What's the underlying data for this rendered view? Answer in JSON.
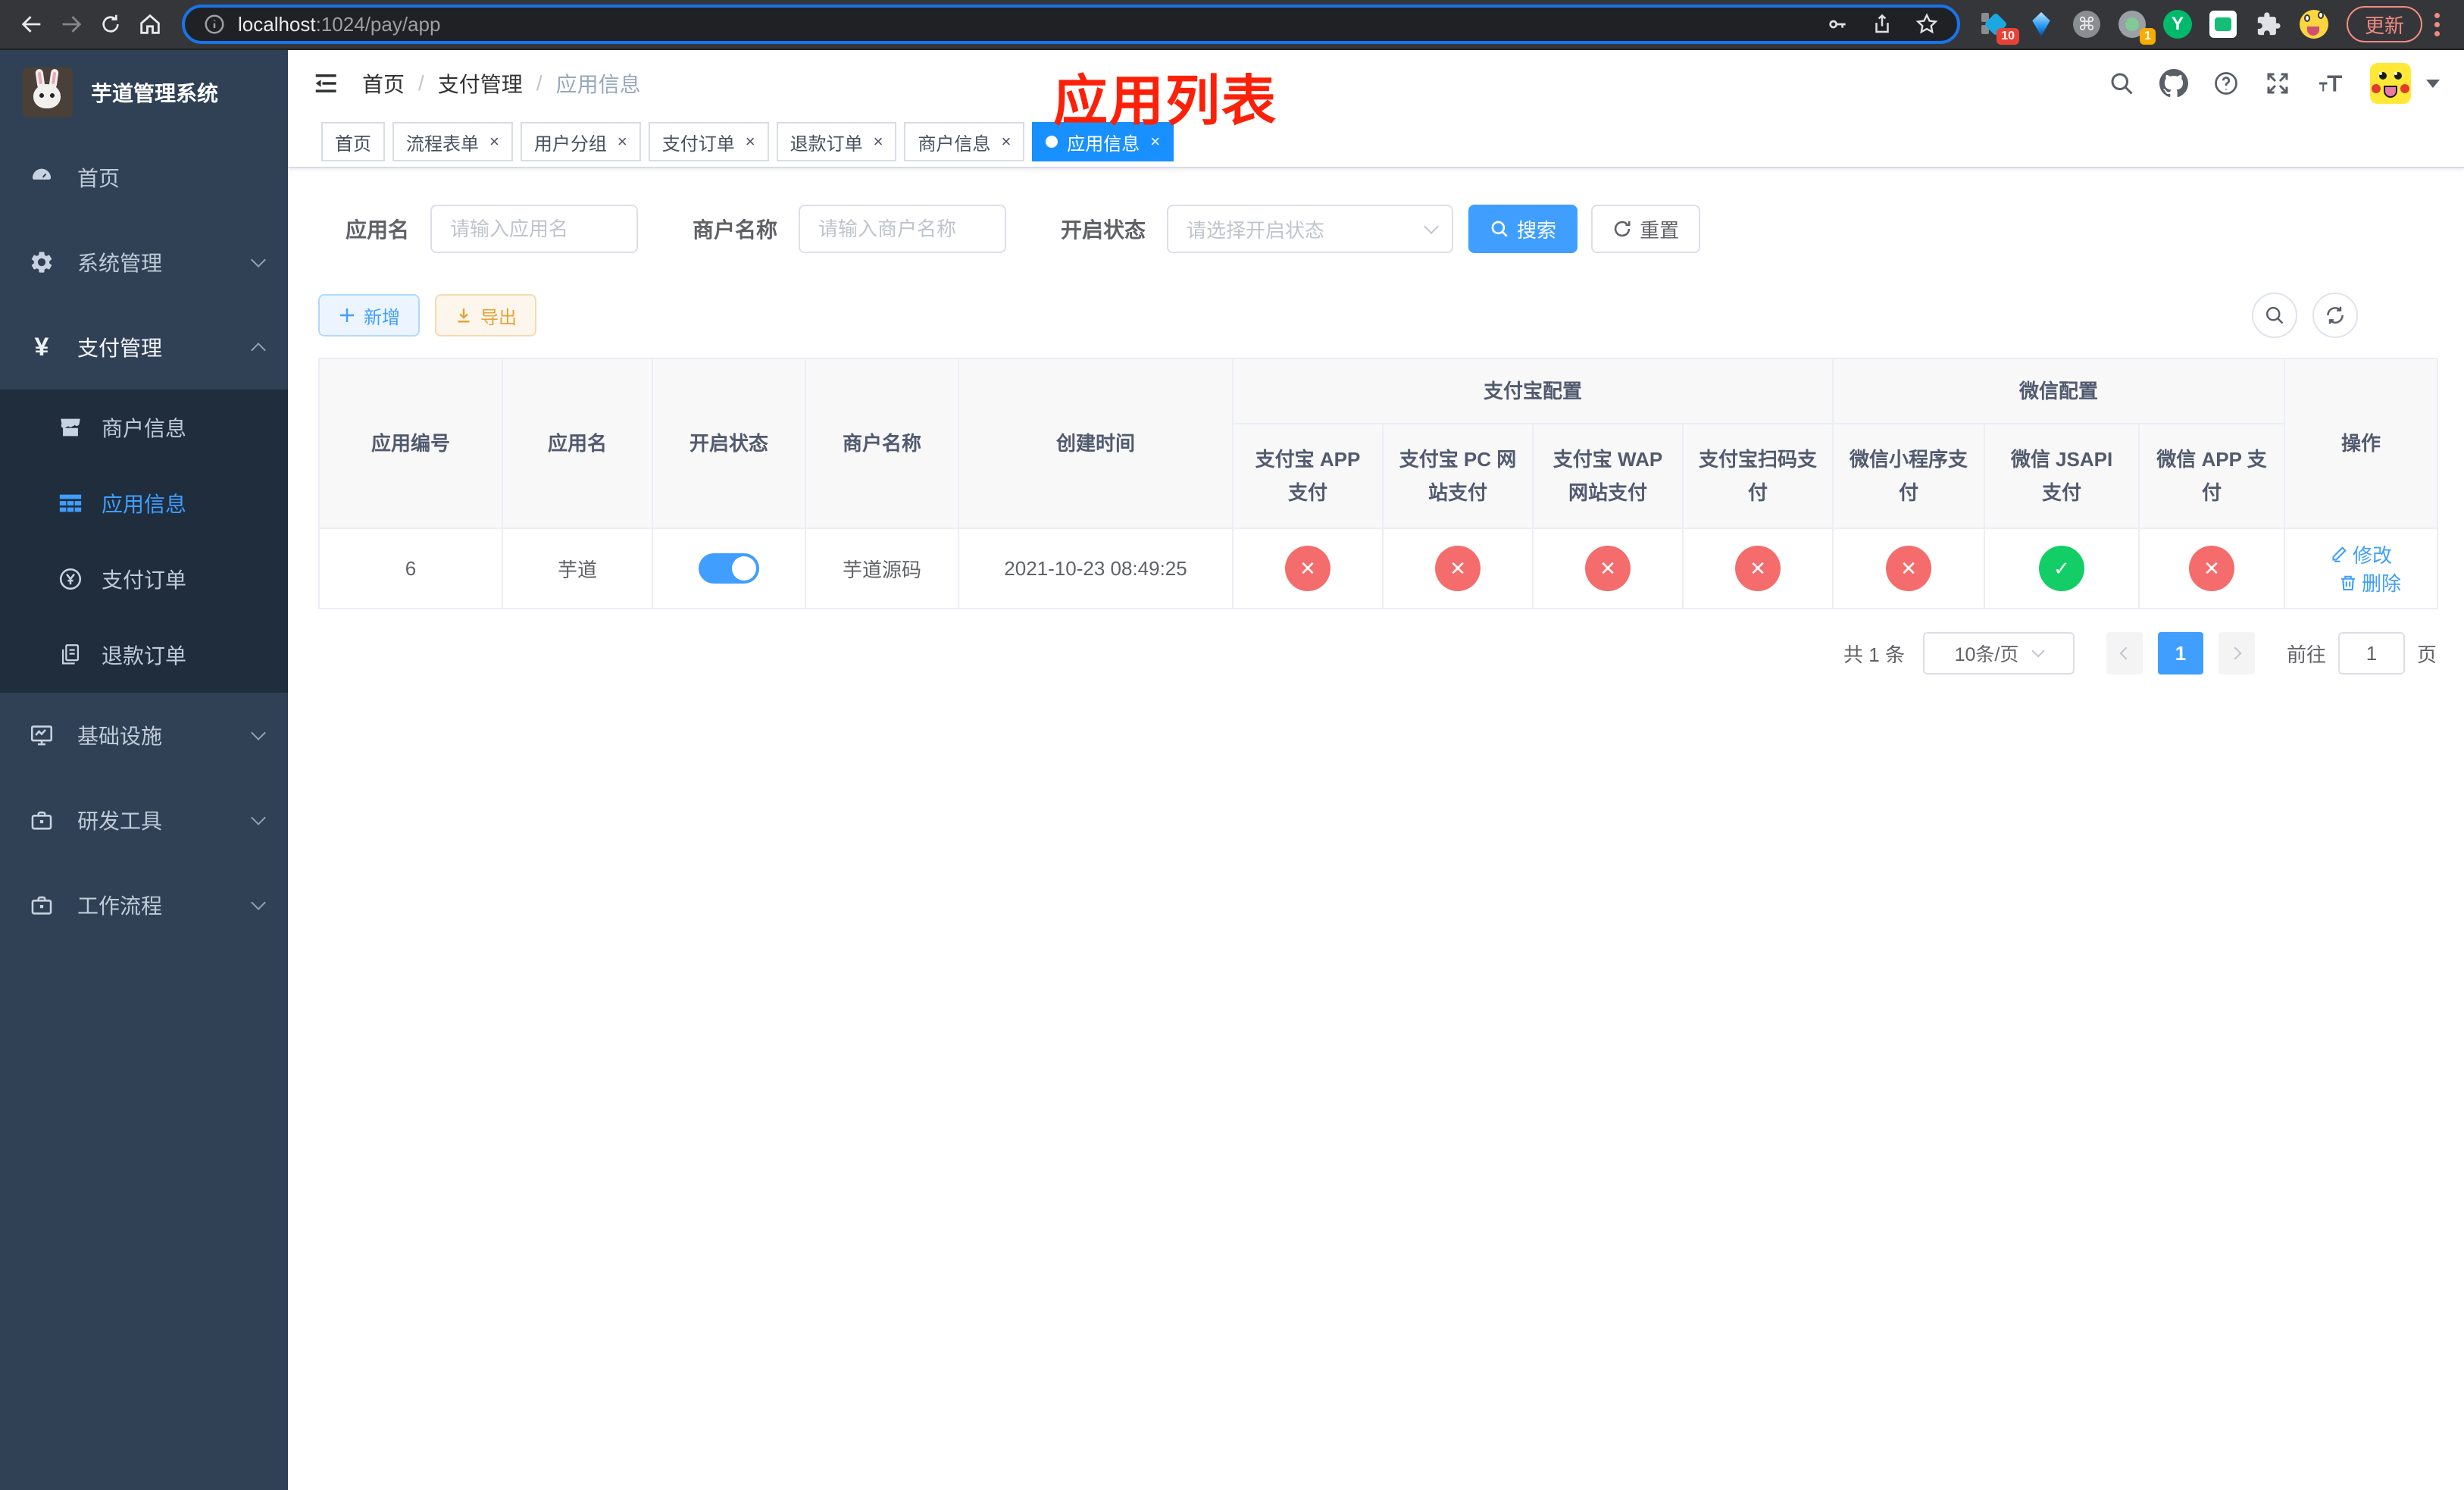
{
  "browser": {
    "url": {
      "host": "localhost",
      "path": ":1024/pay/app"
    },
    "extension_badges": {
      "diamond": "10",
      "proxy": "1"
    },
    "yuque_letter": "Y",
    "command_glyph": "⌘",
    "update_label": "更新"
  },
  "sidebar": {
    "title": "芋道管理系统",
    "items": [
      {
        "label": "首页"
      },
      {
        "label": "系统管理"
      },
      {
        "label": "支付管理"
      },
      {
        "label": "基础设施"
      },
      {
        "label": "研发工具"
      },
      {
        "label": "工作流程"
      }
    ],
    "payment_submenu": [
      {
        "label": "商户信息"
      },
      {
        "label": "应用信息"
      },
      {
        "label": "支付订单"
      },
      {
        "label": "退款订单"
      }
    ]
  },
  "header": {
    "breadcrumb": [
      "首页",
      "支付管理",
      "应用信息"
    ],
    "annotation": "应用列表"
  },
  "tabs": [
    {
      "label": "首页"
    },
    {
      "label": "流程表单"
    },
    {
      "label": "用户分组"
    },
    {
      "label": "支付订单"
    },
    {
      "label": "退款订单"
    },
    {
      "label": "商户信息"
    },
    {
      "label": "应用信息"
    }
  ],
  "filters": {
    "app_name": {
      "label": "应用名",
      "placeholder": "请输入应用名"
    },
    "merchant_name": {
      "label": "商户名称",
      "placeholder": "请输入商户名称"
    },
    "status": {
      "label": "开启状态",
      "placeholder": "请选择开启状态"
    },
    "search_label": "搜索",
    "reset_label": "重置"
  },
  "toolbar": {
    "add_label": "新增",
    "export_label": "导出"
  },
  "table": {
    "columns": [
      "应用编号",
      "应用名",
      "开启状态",
      "商户名称",
      "创建时间"
    ],
    "groups": [
      {
        "label": "支付宝配置",
        "children": [
          "支付宝 APP 支付",
          "支付宝 PC 网站支付",
          "支付宝 WAP 网站支付",
          "支付宝扫码支付"
        ]
      },
      {
        "label": "微信配置",
        "children": [
          "微信小程序支付",
          "微信 JSAPI 支付",
          "微信 APP 支付"
        ]
      }
    ],
    "actions_column": "操作",
    "rows": [
      {
        "app_id": "6",
        "app_name": "芋道",
        "enabled": true,
        "merchant_name": "芋道源码",
        "created_at": "2021-10-23 08:49:25",
        "pay_configs": [
          {
            "state": "no",
            "glyph": "✕"
          },
          {
            "state": "no",
            "glyph": "✕"
          },
          {
            "state": "no",
            "glyph": "✕"
          },
          {
            "state": "no",
            "glyph": "✕"
          },
          {
            "state": "no",
            "glyph": "✕"
          },
          {
            "state": "yes",
            "glyph": "✓"
          },
          {
            "state": "no",
            "glyph": "✕"
          }
        ],
        "edit_label": "修改",
        "delete_label": "删除"
      }
    ]
  },
  "pagination": {
    "total": "共 1 条",
    "page_size": "10条/页",
    "page": "1",
    "goto_label": "前往",
    "goto_value": "1",
    "unit_label": "页"
  },
  "colors": {
    "primary": "#409eff",
    "tab_active": "#1890ff",
    "success": "#13ce66",
    "danger": "#f56c6c",
    "warning": "#e6a23c",
    "annotation_red": "#fb2109",
    "sidebar_bg": "#304156",
    "submenu_bg": "#1f2d3d"
  }
}
